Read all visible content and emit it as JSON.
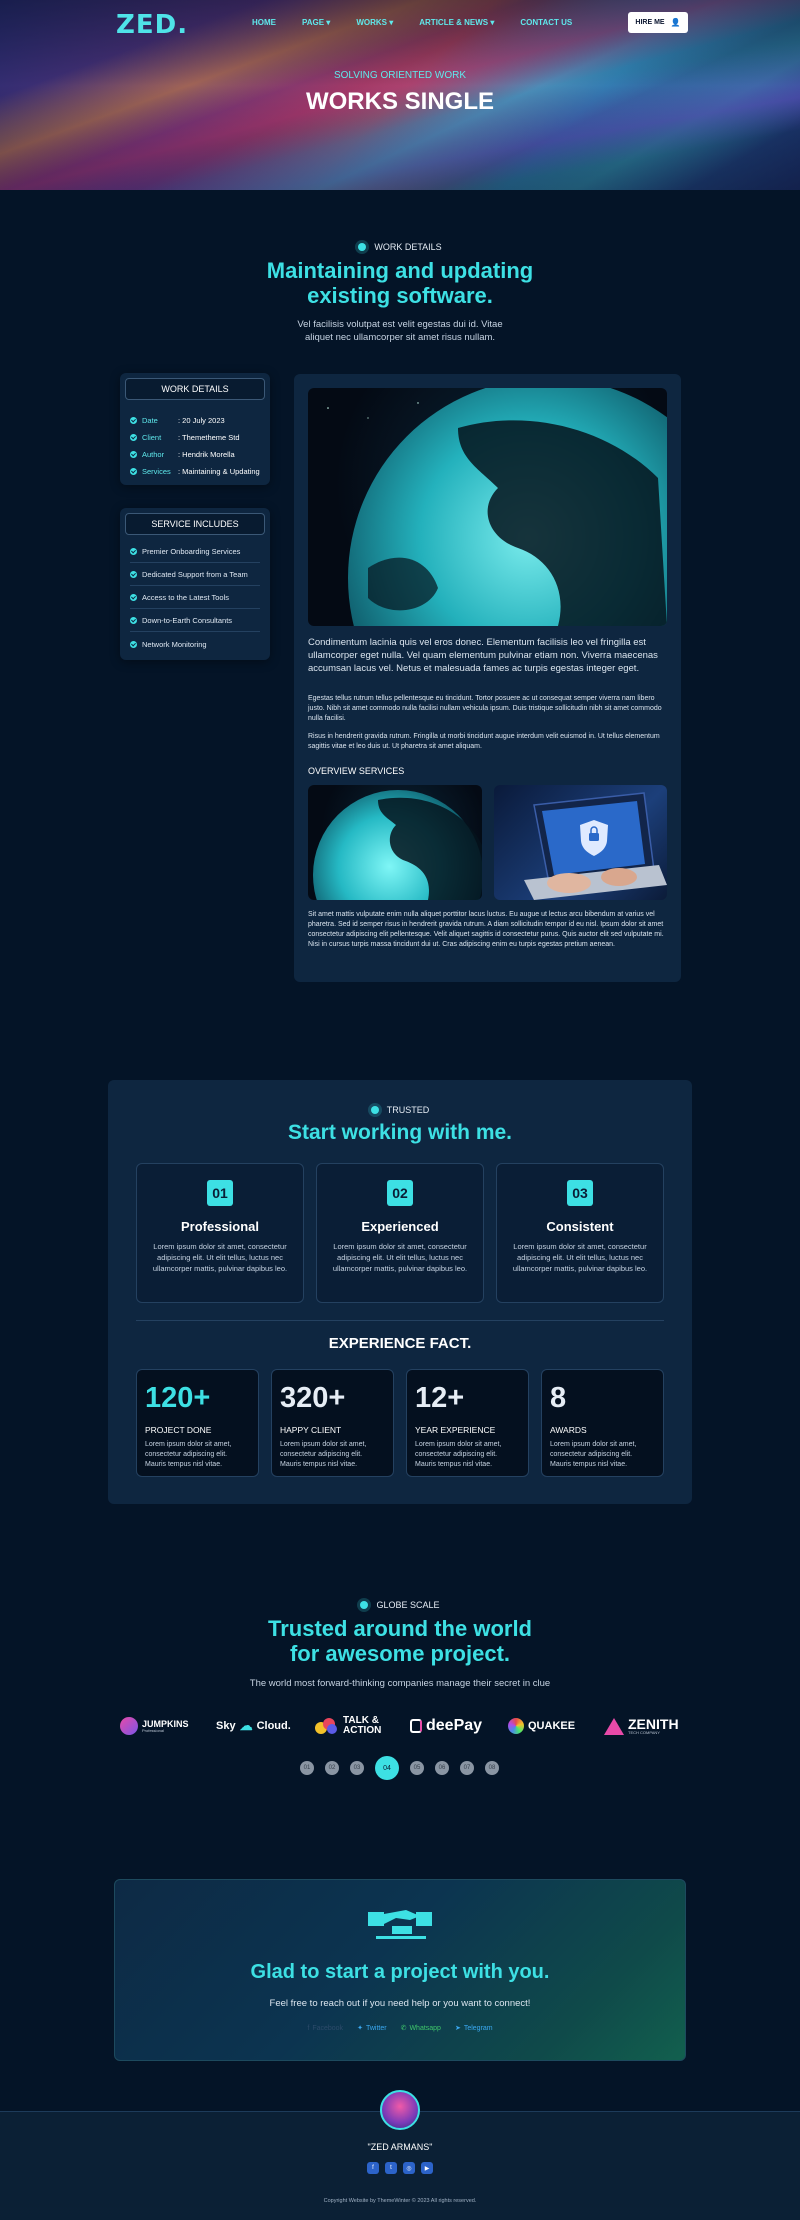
{
  "header": {
    "logo": "ZED.",
    "nav": [
      "HOME",
      "PAGE",
      "WORKS",
      "ARTICLE & NEWS",
      "CONTACT US"
    ],
    "hire_label": "HIRE ME"
  },
  "hero": {
    "subtitle": "SOLVING ORIENTED WORK",
    "title": "WORKS SINGLE"
  },
  "work_intro": {
    "eyebrow": "WORK DETAILS",
    "title_line1": "Maintaining and updating",
    "title_line2": "existing software.",
    "text_line1": "Vel facilisis volutpat est velit egestas dui id. Vitae",
    "text_line2": "aliquet nec ullamcorper sit amet risus nullam."
  },
  "details_card": {
    "title": "WORK DETAILS",
    "rows": [
      {
        "key": "Date",
        "value": ": 20 July 2023"
      },
      {
        "key": "Client",
        "value": ": Themetheme Std"
      },
      {
        "key": "Author",
        "value": ": Hendrik Morella"
      },
      {
        "key": "Services",
        "value": ": Maintaining & Updating"
      }
    ]
  },
  "services_card": {
    "title": "SERVICE INCLUDES",
    "items": [
      "Premier Onboarding Services",
      "Dedicated Support from a Team",
      "Access to the Latest Tools",
      "Down-to-Earth Consultants",
      "Network Monitoring"
    ]
  },
  "main": {
    "lead": "Condimentum lacinia quis vel eros donec. Elementum facilisis leo vel fringilla est ullamcorper eget nulla. Vel quam elementum pulvinar etiam non. Viverra maecenas accumsan lacus vel. Netus et malesuada fames ac turpis egestas integer eget.",
    "p1": "Egestas tellus rutrum tellus pellentesque eu tincidunt. Tortor posuere ac ut consequat semper viverra nam libero justo. Nibh sit amet commodo nulla facilisi nullam vehicula ipsum. Duis tristique sollicitudin nibh sit amet commodo nulla facilisi.",
    "p2": "Risus in hendrerit gravida rutrum. Fringilla ut morbi tincidunt augue interdum velit euismod in. Ut tellus elementum sagittis vitae et leo duis ut. Ut pharetra sit amet aliquam.",
    "overview_title": "OVERVIEW SERVICES",
    "p3": "Sit amet mattis vulputate enim nulla aliquet porttitor lacus luctus. Eu augue ut lectus arcu bibendum at varius vel pharetra. Sed id semper risus in hendrerit gravida rutrum. A diam sollicitudin tempor id eu nisl. Ipsum dolor sit amet consectetur adipiscing elit pellentesque. Velit aliquet sagittis id consectetur purus. Quis auctor elit sed vulputate mi. Nisi in cursus turpis massa tincidunt dui ut. Cras adipiscing enim eu turpis egestas pretium aenean."
  },
  "trusted": {
    "eyebrow": "TRUSTED",
    "title": "Start working with me.",
    "features": [
      {
        "num": "01",
        "title": "Professional",
        "text": "Lorem ipsum dolor sit amet, consectetur adipiscing elit. Ut elit tellus, luctus nec ullamcorper mattis, pulvinar dapibus leo."
      },
      {
        "num": "02",
        "title": "Experienced",
        "text": "Lorem ipsum dolor sit amet, consectetur adipiscing elit. Ut elit tellus, luctus nec ullamcorper mattis, pulvinar dapibus leo."
      },
      {
        "num": "03",
        "title": "Consistent",
        "text": "Lorem ipsum dolor sit amet, consectetur adipiscing elit. Ut elit tellus, luctus nec ullamcorper mattis, pulvinar dapibus leo."
      }
    ],
    "fact_title": "EXPERIENCE FACT.",
    "stats": [
      {
        "num": "120+",
        "label": "PROJECT DONE",
        "text": "Lorem ipsum dolor sit amet, consectetur adipiscing elit. Mauris tempus nisl vitae.",
        "color": "#3de0e4"
      },
      {
        "num": "320+",
        "label": "HAPPY CLIENT",
        "text": "Lorem ipsum dolor sit amet, consectetur adipiscing elit. Mauris tempus nisl vitae.",
        "color": "#ffffff"
      },
      {
        "num": "12+",
        "label": "YEAR EXPERIENCE",
        "text": "Lorem ipsum dolor sit amet, consectetur adipiscing elit. Mauris tempus nisl vitae.",
        "color": "#ffffff"
      },
      {
        "num": "8",
        "label": "AWARDS",
        "text": "Lorem ipsum dolor sit amet, consectetur adipiscing elit. Mauris tempus nisl vitae.",
        "color": "#ffffff"
      }
    ]
  },
  "globe": {
    "eyebrow": "GLOBE SCALE",
    "title_line1": "Trusted around the world",
    "title_line2": "for awesome project.",
    "text": "The world most forward-thinking companies manage their secret in clue",
    "brands": [
      "JUMPKINS",
      "Sky",
      "Cloud.",
      "TALK &",
      "ACTION",
      "deePay",
      "QUAKEE",
      "ZENITH"
    ],
    "brand_sub": [
      "Professional",
      "TECH COMPANY"
    ],
    "pager": [
      "01",
      "02",
      "03",
      "04",
      "05",
      "06",
      "07",
      "08"
    ],
    "active_page": 3
  },
  "cta": {
    "title": "Glad to start a project with you.",
    "text": "Feel free to reach out if you need help or you want to connect!",
    "socials": [
      "Facebook",
      "Twitter",
      "Whatsapp",
      "Telegram"
    ]
  },
  "footer": {
    "name": "\"ZED ARMANS\"",
    "copyright": "Copyright Website by ThemeWinter © 2023 All rights reserved."
  },
  "colors": {
    "accent": "#3de0e4",
    "background": "#041427",
    "card": "#0e2640"
  }
}
